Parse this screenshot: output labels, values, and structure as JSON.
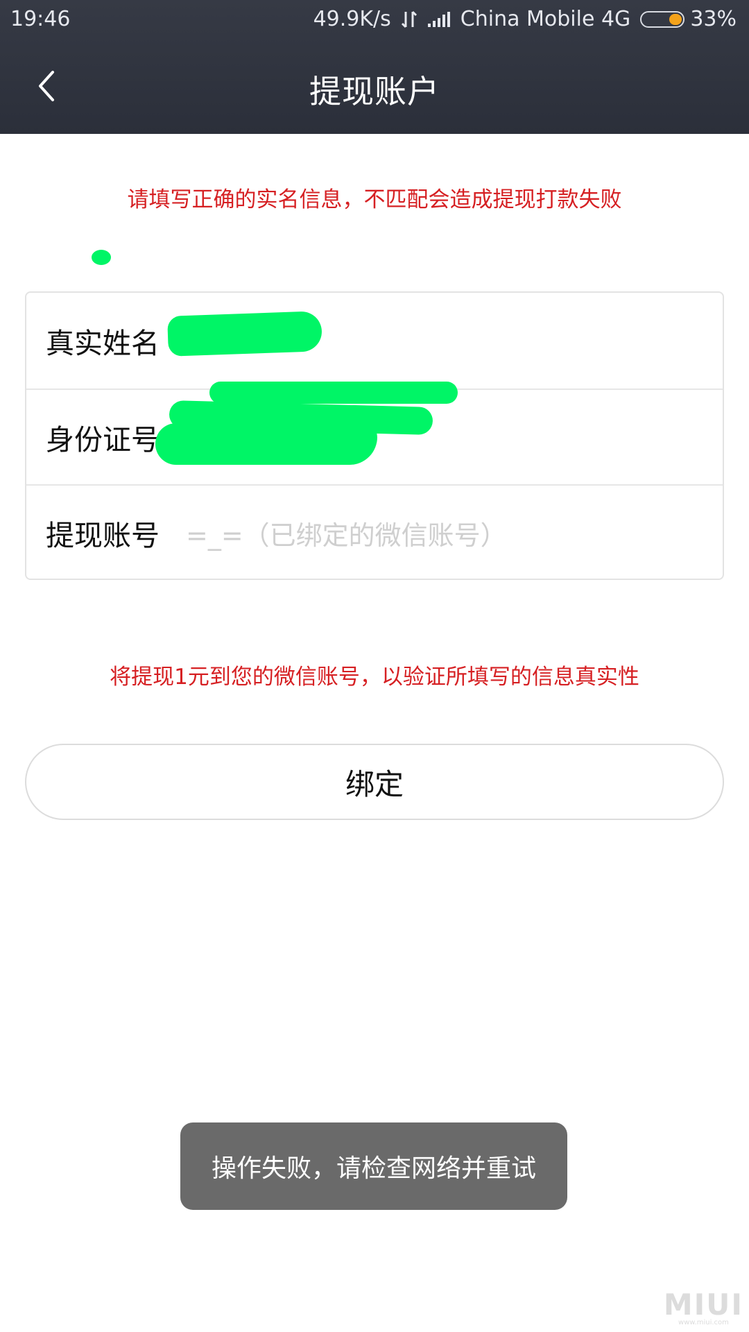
{
  "status_bar": {
    "time": "19:46",
    "speed": "49.9K/s",
    "carrier": "China Mobile 4G",
    "battery_percent_label": "33%",
    "battery_level": 0.33,
    "battery_color": "#f3a21a"
  },
  "header": {
    "title": "提现账户",
    "back_icon": "chevron-left-icon"
  },
  "notices": {
    "top": "请填写正确的实名信息，不匹配会造成提现打款失败",
    "middle": "将提现1元到您的微信账号，以验证所填写的信息真实性",
    "color": "#d62023"
  },
  "form": {
    "rows": [
      {
        "label": "真实姓名",
        "value": ""
      },
      {
        "label": "身份证号",
        "value": ""
      },
      {
        "label": "提现账号",
        "value": "=_=（已绑定的微信账号）"
      }
    ]
  },
  "bind_button": {
    "label": "绑定"
  },
  "toast": {
    "message": "操作失败，请检查网络并重试"
  },
  "watermark": {
    "text": "MIUI",
    "subtext": "www.miui.com"
  }
}
